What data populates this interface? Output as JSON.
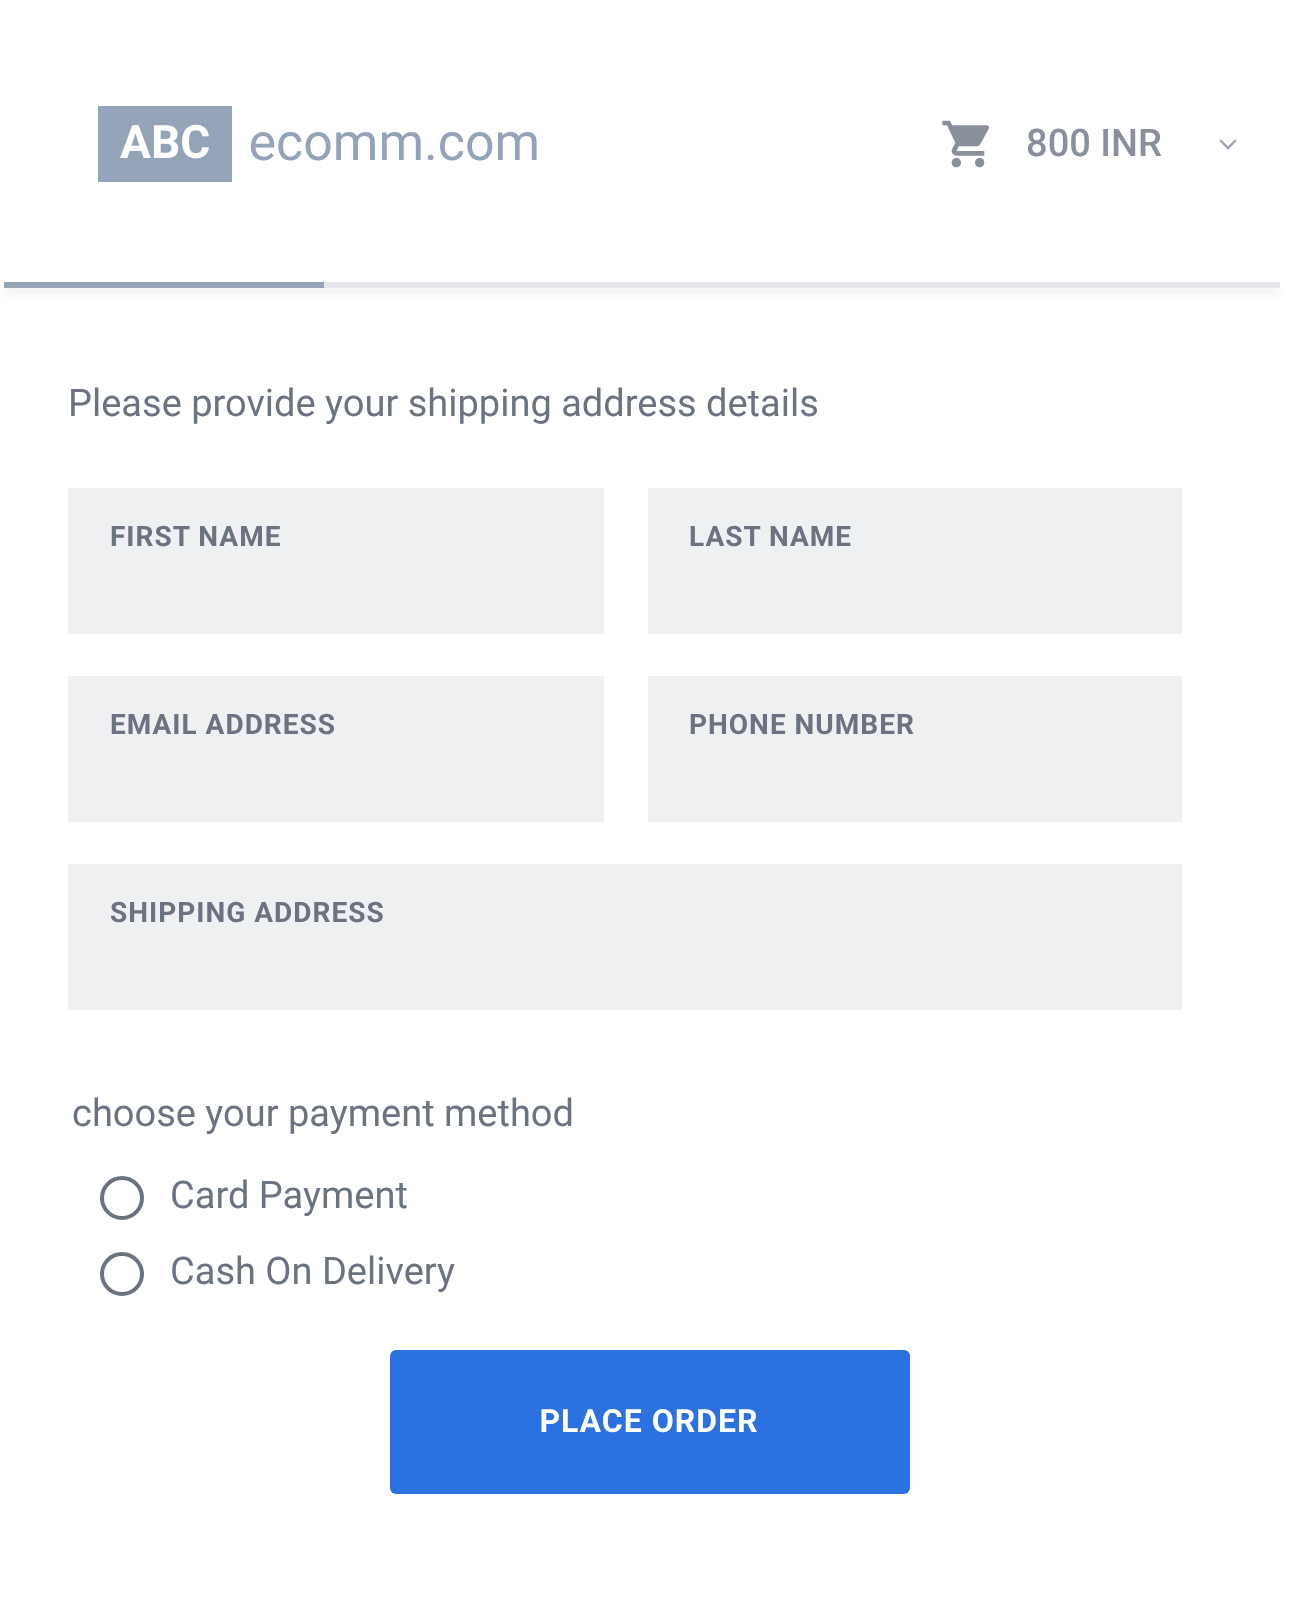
{
  "header": {
    "logo_badge": "ABC",
    "logo_text": "ecomm.com",
    "cart_total": "800 INR"
  },
  "progress": {
    "level": 0.25
  },
  "form": {
    "heading": "Please provide your shipping address details",
    "fields": [
      {
        "label": "FIRST NAME",
        "kind": "half"
      },
      {
        "label": "LAST NAME",
        "kind": "half"
      },
      {
        "label": "EMAIL ADDRESS",
        "kind": "half"
      },
      {
        "label": "PHONE NUMBER",
        "kind": "half"
      },
      {
        "label": "SHIPPING ADDRESS",
        "kind": "full"
      }
    ]
  },
  "payment": {
    "heading": "choose your payment method",
    "options": [
      {
        "label": "Card Payment",
        "selected": false
      },
      {
        "label": "Cash On Delivery",
        "selected": false
      }
    ]
  },
  "submit": "PLACE ORDER"
}
